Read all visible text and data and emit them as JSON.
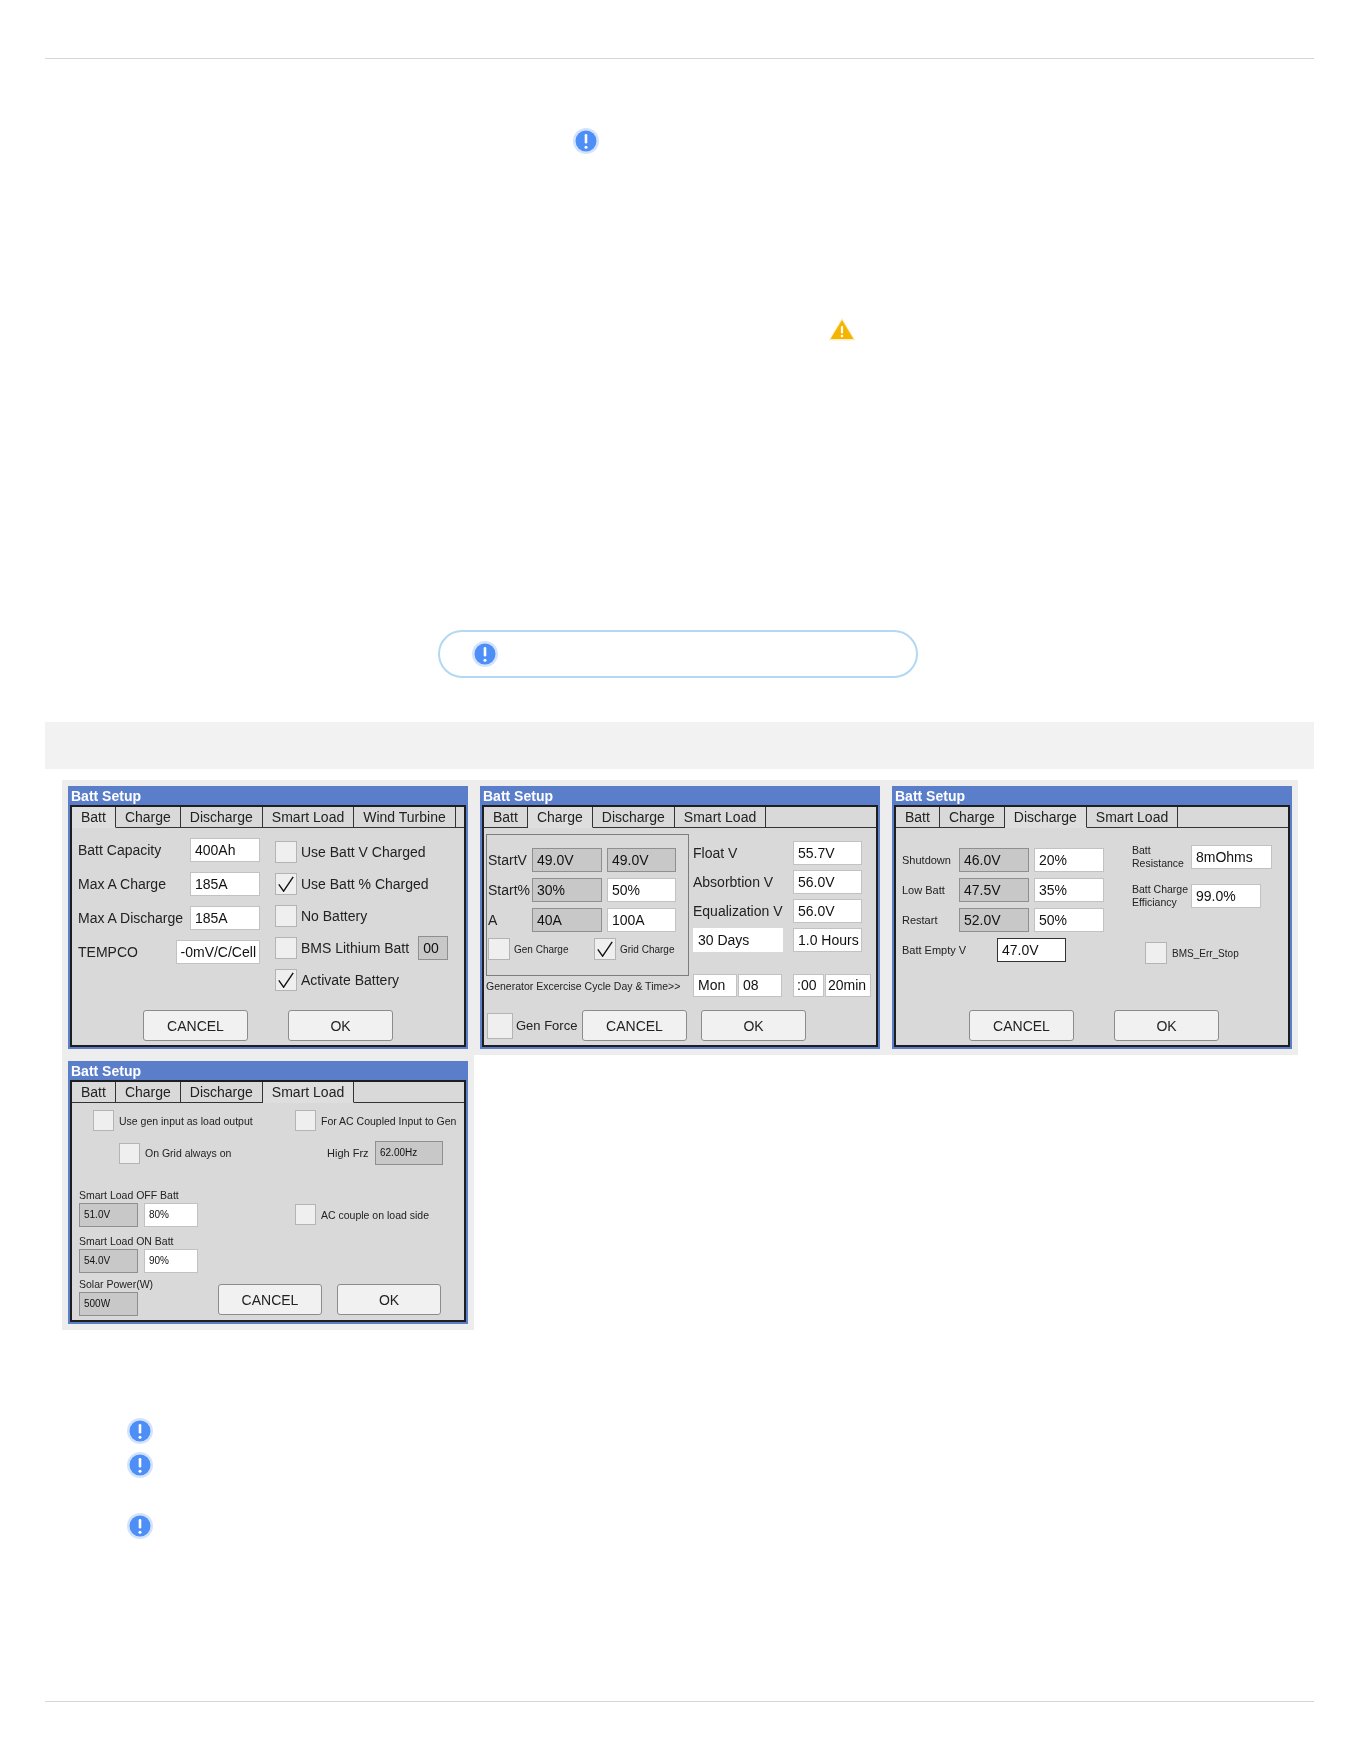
{
  "dialogs": [
    {
      "kind": "batt",
      "title": "Batt Setup",
      "tabs": [
        {
          "label": "Batt",
          "selected": true
        },
        {
          "label": "Charge",
          "selected": false
        },
        {
          "label": "Discharge",
          "selected": false
        },
        {
          "label": "Smart Load",
          "selected": false
        },
        {
          "label": "Wind Turbine",
          "selected": false
        }
      ],
      "fields": [
        {
          "label": "Batt Capacity",
          "input": {
            "value": "400Ah",
            "disabled": false
          }
        },
        {
          "label": "Max A Charge",
          "input": {
            "value": "185A",
            "disabled": false
          }
        },
        {
          "label": "Max A Discharge",
          "input": {
            "value": "185A",
            "disabled": false
          }
        },
        {
          "label": "TEMPCO",
          "input": {
            "value": "-0mV/C/Cell",
            "disabled": false
          }
        }
      ],
      "options": [
        {
          "label": "Use Batt V Charged",
          "checked": false
        },
        {
          "label": "Use Batt % Charged",
          "checked": true
        },
        {
          "label": "No Battery",
          "checked": false
        },
        {
          "label": "BMS Lithium Batt",
          "checked": false,
          "input": {
            "value": "00",
            "disabled": true
          }
        },
        {
          "label": "Activate Battery",
          "checked": true
        }
      ],
      "buttons": [
        "CANCEL",
        "OK"
      ]
    },
    {
      "kind": "charge",
      "title": "Batt Setup",
      "tabs": [
        {
          "label": "Batt",
          "selected": false
        },
        {
          "label": "Charge",
          "selected": true
        },
        {
          "label": "Discharge",
          "selected": false
        },
        {
          "label": "Smart Load",
          "selected": false
        }
      ],
      "group": {
        "rows": [
          {
            "label": "StartV",
            "inputs": [
              {
                "value": "49.0V",
                "disabled": true
              },
              {
                "value": "49.0V",
                "disabled": true
              }
            ]
          },
          {
            "label": "Start%",
            "inputs": [
              {
                "value": "30%",
                "disabled": true
              },
              {
                "value": "50%",
                "disabled": false
              }
            ]
          },
          {
            "label": "A",
            "inputs": [
              {
                "value": "40A",
                "disabled": true
              },
              {
                "value": "100A",
                "disabled": false
              }
            ]
          }
        ],
        "options": [
          {
            "label": "Gen Charge",
            "checked": false
          },
          {
            "label": "Grid Charge",
            "checked": true
          }
        ]
      },
      "settings": [
        {
          "label": "Float V",
          "input": {
            "value": "55.7V",
            "disabled": false
          }
        },
        {
          "label": "Absorbtion V",
          "input": {
            "value": "56.0V",
            "disabled": false
          }
        },
        {
          "label": "Equalization V",
          "input": {
            "value": "56.0V",
            "disabled": false
          }
        }
      ],
      "periods": [
        {
          "value": "30 Days",
          "disabled": false
        },
        {
          "value": "1.0 Hours",
          "disabled": false
        }
      ],
      "exercise": {
        "label": "Generator Excercise Cycle Day & Time>>",
        "inputs": [
          {
            "value": "Mon",
            "disabled": false
          },
          {
            "value": "08",
            "disabled": false
          },
          {
            "value": ":00",
            "disabled": false
          },
          {
            "value": "20min",
            "disabled": false
          }
        ]
      },
      "gen_force": {
        "label": "Gen Force",
        "checked": false
      },
      "buttons": [
        "CANCEL",
        "OK"
      ]
    },
    {
      "kind": "discharge",
      "title": "Batt Setup",
      "tabs": [
        {
          "label": "Batt",
          "selected": false
        },
        {
          "label": "Charge",
          "selected": false
        },
        {
          "label": "Discharge",
          "selected": true
        },
        {
          "label": "Smart Load",
          "selected": false
        }
      ],
      "rows": [
        {
          "label": "Shutdown",
          "inputs": [
            {
              "value": "46.0V",
              "disabled": true
            },
            {
              "value": "20%",
              "disabled": false
            }
          ]
        },
        {
          "label": "Low Batt",
          "inputs": [
            {
              "value": "47.5V",
              "disabled": true
            },
            {
              "value": "35%",
              "disabled": false
            }
          ]
        },
        {
          "label": "Restart",
          "inputs": [
            {
              "value": "52.0V",
              "disabled": true
            },
            {
              "value": "50%",
              "disabled": false
            }
          ]
        }
      ],
      "empty_v": {
        "label": "Batt Empty V",
        "input": {
          "value": "47.0V",
          "disabled": false
        }
      },
      "right_fields": [
        {
          "label": "Batt Resistance",
          "input": {
            "value": "8mOhms",
            "disabled": false
          }
        },
        {
          "label": "Batt Charge Efficiancy",
          "input": {
            "value": "99.0%",
            "disabled": false
          }
        }
      ],
      "bms_err_stop": {
        "label": "BMS_Err_Stop",
        "checked": false
      },
      "buttons": [
        "CANCEL",
        "OK"
      ]
    },
    {
      "kind": "smart_load",
      "title": "Batt Setup",
      "tabs": [
        {
          "label": "Batt",
          "selected": false
        },
        {
          "label": "Charge",
          "selected": false
        },
        {
          "label": "Discharge",
          "selected": false
        },
        {
          "label": "Smart Load",
          "selected": true
        }
      ],
      "gen_load": {
        "label": "Use gen input as load output",
        "checked": false
      },
      "ac_coupled_gen": {
        "label": "For AC Coupled Input to Gen",
        "checked": false
      },
      "grid_always_on": {
        "label": "On Grid always on",
        "checked": false
      },
      "high_frz": {
        "label": "High Frz",
        "input": {
          "value": "62.00Hz",
          "disabled": true
        }
      },
      "batt_levels": [
        {
          "label": "Smart Load OFF Batt",
          "inputs": [
            {
              "value": "51.0V",
              "disabled": true
            },
            {
              "value": "80%",
              "disabled": false
            }
          ]
        },
        {
          "label": "Smart Load ON Batt",
          "inputs": [
            {
              "value": "54.0V",
              "disabled": true
            },
            {
              "value": "90%",
              "disabled": false
            }
          ]
        }
      ],
      "ac_couple_load": {
        "label": "AC couple on load side",
        "checked": false
      },
      "solar_power": {
        "label": "Solar Power(W)",
        "input": {
          "value": "500W",
          "disabled": true
        }
      },
      "buttons": [
        "CANCEL",
        "OK"
      ]
    }
  ]
}
